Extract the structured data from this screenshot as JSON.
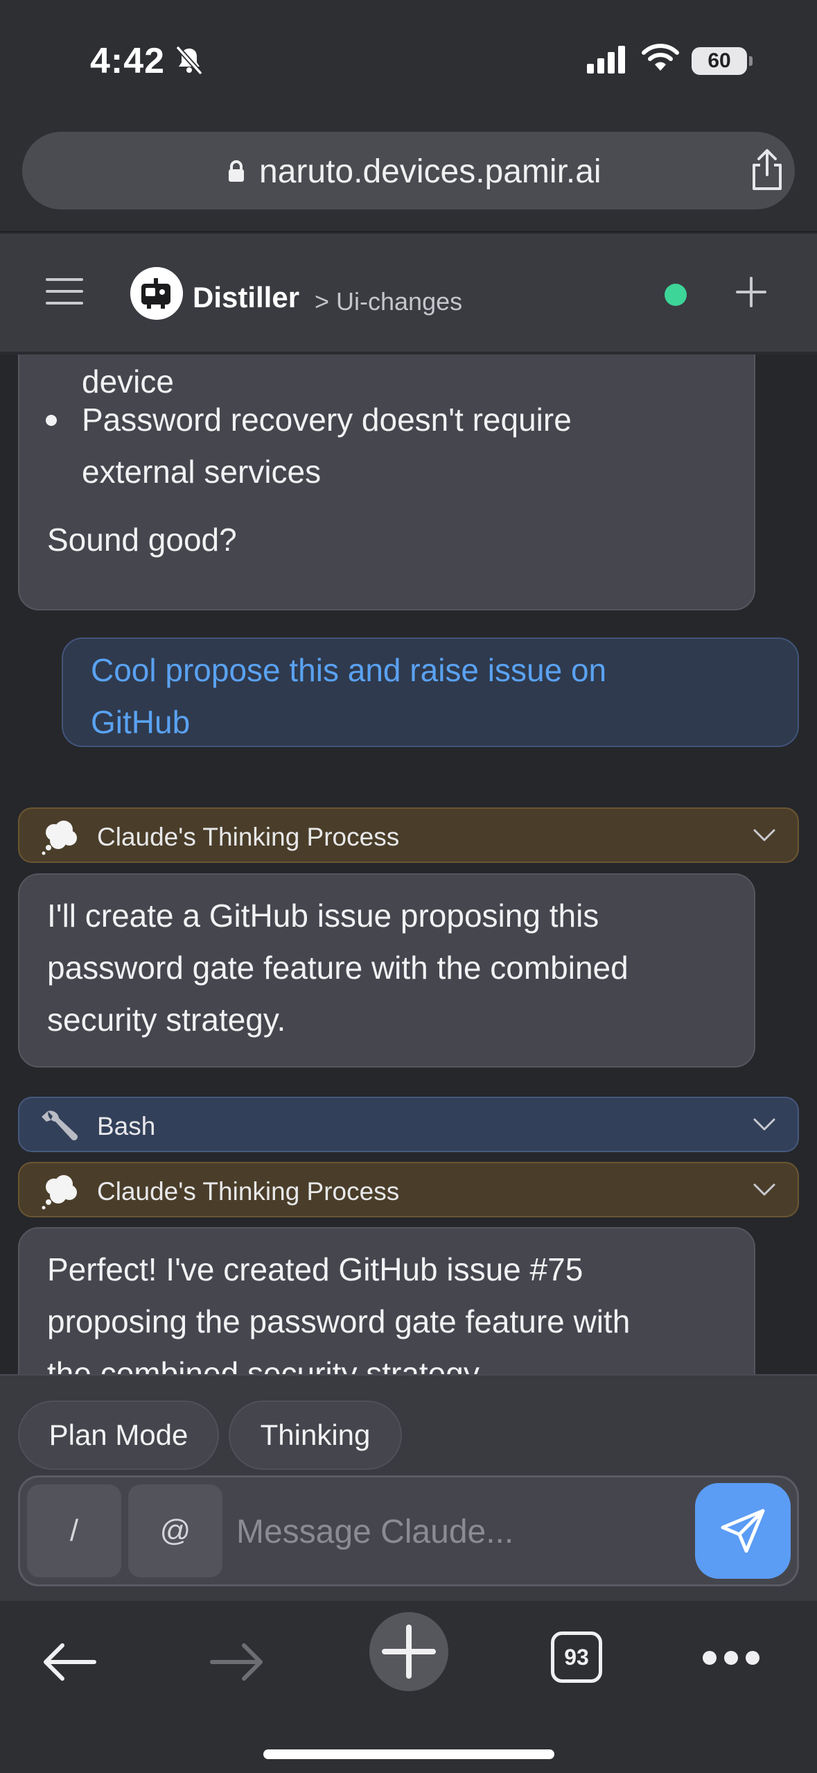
{
  "status_bar": {
    "time": "4:42",
    "battery": "60"
  },
  "browser": {
    "url": "naruto.devices.pamir.ai",
    "tab_count": "93"
  },
  "app": {
    "name": "Distiller",
    "breadcrumb": "> Ui-changes",
    "status_color": "#3dd598"
  },
  "chat": {
    "assistant_1": {
      "line_top": "device",
      "bullet_line_1": "Password recovery doesn't require",
      "bullet_line_2": "external services",
      "closing": "Sound good?"
    },
    "user_1": {
      "line_1": "Cool propose this and raise issue on",
      "line_2": "GitHub"
    },
    "thinking_label": "Claude's Thinking Process",
    "assistant_2": {
      "line_1": "I'll create a GitHub issue proposing this",
      "line_2": "password gate feature with the combined",
      "line_3": "security strategy."
    },
    "tool_label": "Bash",
    "assistant_3": {
      "line_1": "Perfect! I've created GitHub issue #75",
      "line_2": "proposing the password gate feature with",
      "line_3": "the combined security strategy"
    }
  },
  "composer": {
    "mode_buttons": [
      "Plan Mode",
      "Thinking"
    ],
    "slash": "/",
    "at": "@",
    "placeholder": "Message Claude...",
    "value": ""
  },
  "colors": {
    "accent": "#5b9cf5",
    "user_text": "#5aa2f2",
    "thinking_bg": "#4a3e2a",
    "tool_bg": "#33405a"
  }
}
